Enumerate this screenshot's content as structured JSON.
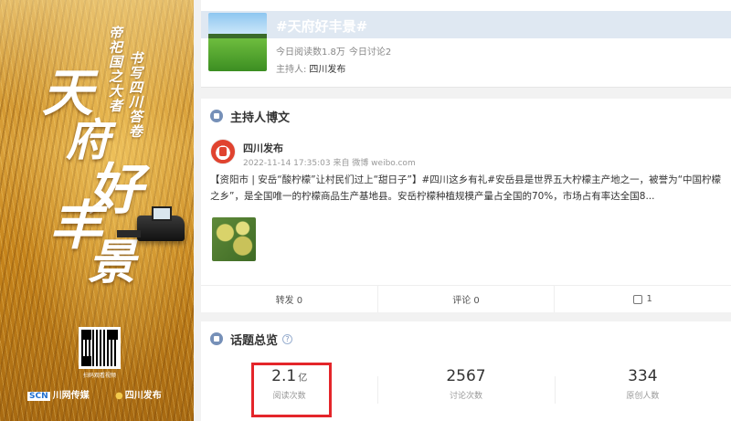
{
  "poster": {
    "subtitle_1": "帝祀国之大者",
    "subtitle_2": "书写四川答卷",
    "title_chars": [
      "天",
      "府",
      "好",
      "丰",
      "景"
    ],
    "qr_caption": "扫码观看视频",
    "brand_left_mark": "SCN",
    "brand_left": "川网传媒",
    "brand_right_mark": "●",
    "brand_right": "四川发布"
  },
  "topic": {
    "title": "#天府好丰景#",
    "reads": "今日阅读数1.8万",
    "discussions": "今日讨论2",
    "host_label": "主持人:",
    "host_name": "四川发布"
  },
  "host_posts": {
    "section_title": "主持人博文",
    "post": {
      "author": "四川发布",
      "meta": "2022-11-14 17:35:03 来自 微博 weibo.com",
      "text": "【资阳市 | 安岳“酸柠檬”让村民们过上“甜日子”】#四川这乡有礼#安岳县是世界五大柠檬主产地之一，被誉为“中国柠檬之乡”，是全国唯一的柠檬商品生产基地县。安岳柠檬种植规模产量占全国的70%，市场占有率达全国8...",
      "repost": "转发 0",
      "comment": "评论 0",
      "like": "1"
    }
  },
  "overview": {
    "section_title": "话题总览",
    "help": "?",
    "stats": [
      {
        "value": "2.1",
        "unit": "亿",
        "label": "阅读次数"
      },
      {
        "value": "2567",
        "unit": "",
        "label": "讨论次数"
      },
      {
        "value": "334",
        "unit": "",
        "label": "原创人数"
      }
    ]
  },
  "colors": {
    "highlight": "#e4252a",
    "section_icon": "#7690b8",
    "header_band": "#dfe8f2"
  }
}
